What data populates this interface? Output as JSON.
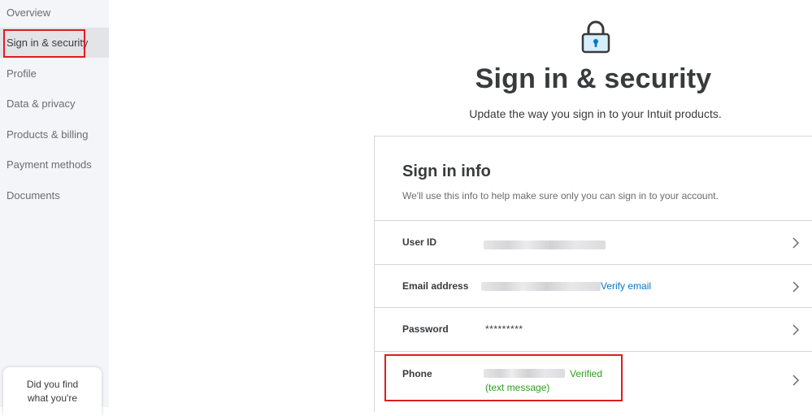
{
  "sidebar": {
    "items": [
      {
        "label": "Overview"
      },
      {
        "label": "Sign in & security"
      },
      {
        "label": "Profile"
      },
      {
        "label": "Data & privacy"
      },
      {
        "label": "Products & billing"
      },
      {
        "label": "Payment methods"
      },
      {
        "label": "Documents"
      }
    ],
    "help_card": {
      "line1": "Did you find",
      "line2": "what you're"
    }
  },
  "header": {
    "icon": "lock-icon",
    "title": "Sign in & security",
    "subtitle": "Update the way you sign in to your Intuit products."
  },
  "signin_info": {
    "title": "Sign in info",
    "description": "We'll use this info to help make sure only you can sign in to your account.",
    "rows": [
      {
        "label": "User ID"
      },
      {
        "label": "Email address",
        "link": "Verify email"
      },
      {
        "label": "Password",
        "value": "*********"
      },
      {
        "label": "Phone",
        "status": "Verified",
        "detail": "(text message)"
      }
    ]
  },
  "colors": {
    "accent_link": "#0077c5",
    "verified_green": "#2ca01c",
    "highlight_red": "#e01b22",
    "sidebar_bg": "#f4f5f8"
  }
}
